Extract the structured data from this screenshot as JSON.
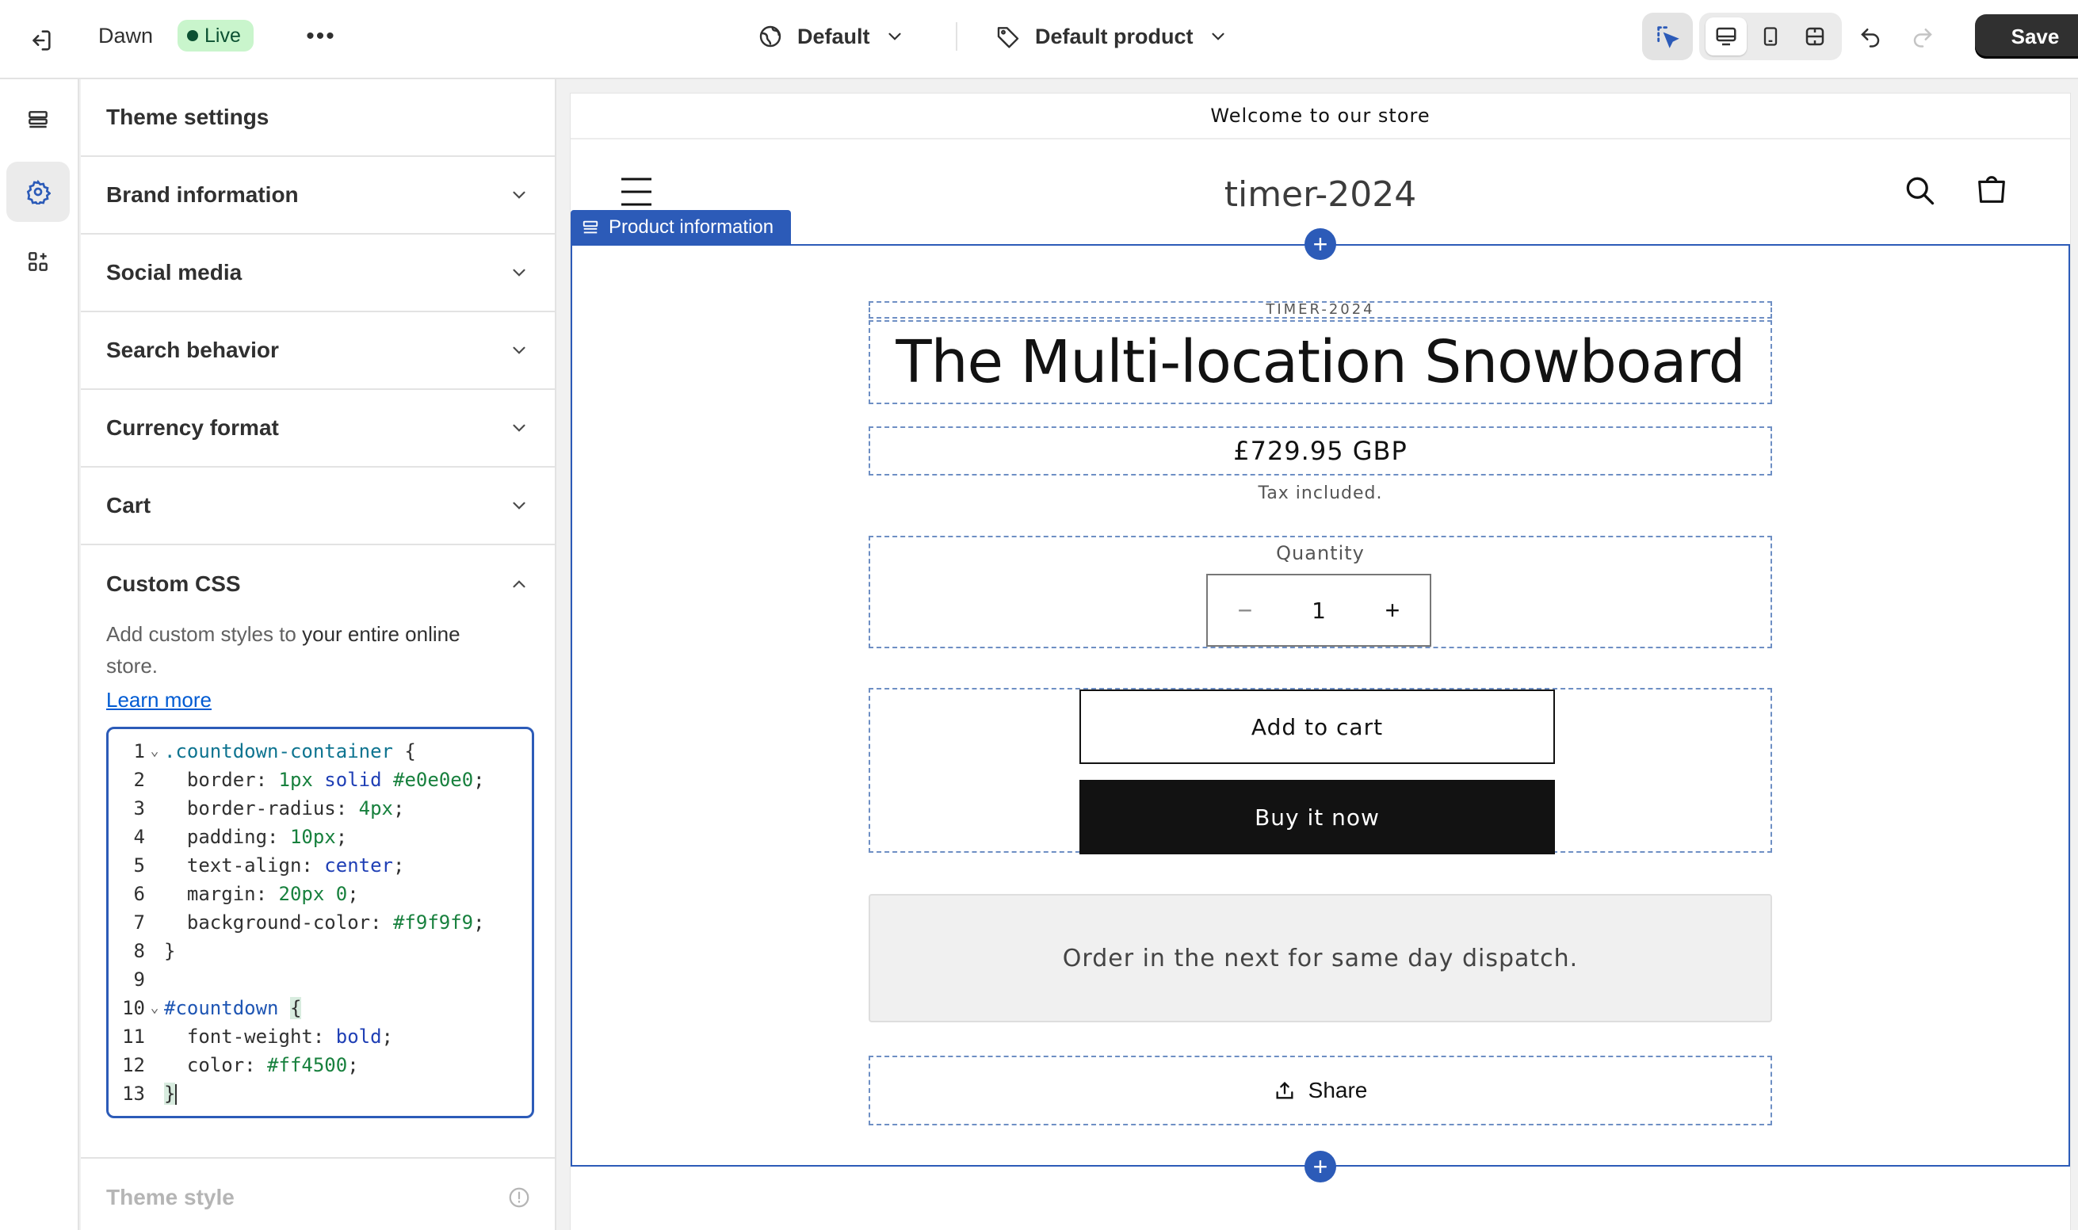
{
  "topbar": {
    "theme_name": "Dawn",
    "status": "Live",
    "more": "•••",
    "template": "Default",
    "product": "Default product",
    "save": "Save"
  },
  "panel": {
    "title": "Theme settings",
    "sections": [
      {
        "label": "Brand information"
      },
      {
        "label": "Social media"
      },
      {
        "label": "Search behavior"
      },
      {
        "label": "Currency format"
      },
      {
        "label": "Cart"
      }
    ],
    "custom_css": {
      "label": "Custom CSS",
      "desc_prefix": "Add custom styles to ",
      "desc_bold": "your entire online",
      "desc_suffix": "store.",
      "learn_more": "Learn more"
    },
    "theme_style": "Theme style"
  },
  "code_lines": [
    {
      "n": "1",
      "fold": "⌄"
    },
    {
      "n": "2"
    },
    {
      "n": "3"
    },
    {
      "n": "4"
    },
    {
      "n": "5"
    },
    {
      "n": "6"
    },
    {
      "n": "7"
    },
    {
      "n": "8"
    },
    {
      "n": "9"
    },
    {
      "n": "10",
      "fold": "⌄"
    },
    {
      "n": "11"
    },
    {
      "n": "12"
    },
    {
      "n": "13"
    }
  ],
  "code": {
    "l1_sel": ".countdown-container",
    "l1_rest": " {",
    "l2_prop": "  border: ",
    "l2_num": "1px",
    "l2_kw": " solid ",
    "l2_hex": "#e0e0e0",
    "l2_end": ";",
    "l3_prop": "  border-radius: ",
    "l3_num": "4px",
    "l3_end": ";",
    "l4_prop": "  padding: ",
    "l4_num": "10px",
    "l4_end": ";",
    "l5_prop": "  text-align: ",
    "l5_kw": "center",
    "l5_end": ";",
    "l6_prop": "  margin: ",
    "l6_num": "20px 0",
    "l6_end": ";",
    "l7_prop": "  background-color: ",
    "l7_hex": "#f9f9f9",
    "l7_end": ";",
    "l8": "}",
    "l10_id": "#countdown",
    "l10_brace": "{",
    "l11_prop": "  font-weight: ",
    "l11_kw": "bold",
    "l11_end": ";",
    "l12_prop": "  color: ",
    "l12_hex": "#ff4500",
    "l12_end": ";",
    "l13": "}"
  },
  "preview": {
    "announcement": "Welcome to our store",
    "store_name": "timer-2024",
    "section_tag": "Product information",
    "vendor": "TIMER-2024",
    "title": "The Multi-location Snowboard",
    "price": "£729.95 GBP",
    "tax": "Tax included.",
    "quantity_label": "Quantity",
    "quantity": "1",
    "add_to_cart": "Add to cart",
    "buy_now": "Buy it now",
    "dispatch": "Order in the next for same day dispatch.",
    "share": "Share"
  },
  "colors": {
    "accent": "#2c5bb8",
    "live_bg": "#c9f5cc",
    "save_bg": "#303030"
  }
}
